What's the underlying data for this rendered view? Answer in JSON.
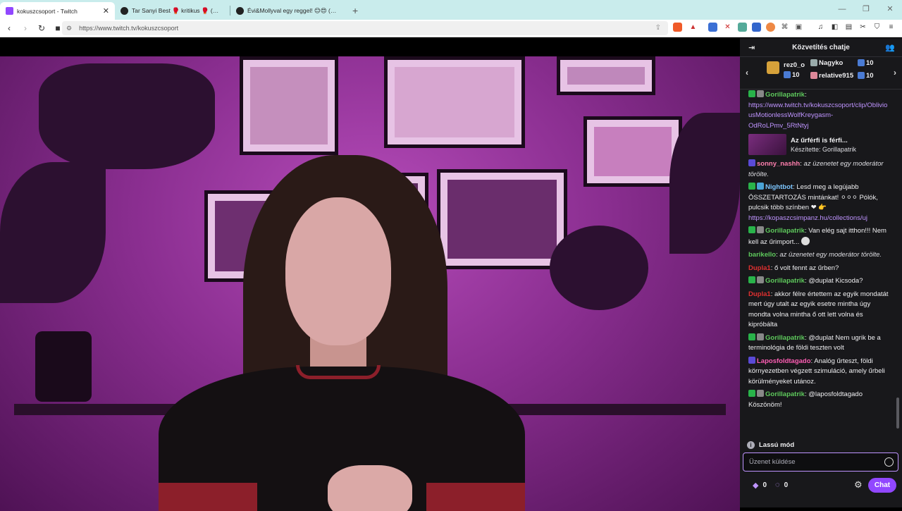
{
  "browser": {
    "tabs": [
      {
        "title": "kokuszcsoport - Twitch",
        "favicon_color": "#9147ff"
      },
      {
        "title": "Tar Sanyi Best 🥊 kritikus 🥊 (@szop",
        "favicon_color": "#222"
      },
      {
        "title": "Évi&Mollyval egy reggel! 😊😍 (@m",
        "favicon_color": "#222"
      }
    ],
    "newtab_label": "+",
    "url": "https://www.twitch.tv/kokuszcsoport"
  },
  "chat": {
    "header_title": "Közvetítés chatje",
    "leaderboard": [
      {
        "name": "rez0_o",
        "count": "10"
      },
      {
        "name": "Nagyko",
        "count": "10"
      },
      {
        "name": "relative915",
        "count": "10"
      }
    ],
    "messages": [
      {
        "user": "Gorillapatrik",
        "color": "#5ec95c",
        "text": "https://www.twitch.tv/kokuszcsoport/clip/ObliviousMotionlessWolfKreygasm-OdRoLPmv_5RtNtyj",
        "type": "link",
        "badges": [
          "mod",
          "vip"
        ]
      },
      {
        "user": "sonny_nashh",
        "color": "#ff7fae",
        "text": "az üzenetet egy moderátor törölte.",
        "type": "deleted",
        "badges": [
          "sub"
        ]
      },
      {
        "user": "Nightbot",
        "color": "#7dc6ff",
        "text": "Lesd meg a legújabb ÖSSZETARTOZÁS mintánkat! ⚪⚪⚪ Pólók, pulcsik több színben ❤ 👉 ",
        "link": "https://kopaszcsimpanz.hu/collections/uj",
        "type": "bot",
        "badges": [
          "mod",
          "bot"
        ]
      },
      {
        "user": "Gorillapatrik",
        "color": "#5ec95c",
        "text": "Van elég sajt itthon!!! Nem kell az űrimport...",
        "type": "normal",
        "badges": [
          "mod",
          "vip"
        ]
      },
      {
        "user": "barikello",
        "color": "#5ec95c",
        "text": "az üzenetet egy moderátor törölte.",
        "type": "deleted",
        "badges": []
      },
      {
        "user": "Dupla1",
        "color": "#e03030",
        "text": "ő volt fennt az űrben?",
        "type": "normal",
        "badges": []
      },
      {
        "user": "Gorillapatrik",
        "color": "#5ec95c",
        "text": "@duplat Kicsoda?",
        "type": "normal",
        "badges": [
          "mod",
          "vip"
        ]
      },
      {
        "user": "Dupla1",
        "color": "#e03030",
        "text": "akkor félre értettem az egyik mondatát mert úgy utalt az egyik esetre mintha úgy mondta volna mintha ő ott lett volna és kipróbálta",
        "type": "normal",
        "badges": []
      },
      {
        "user": "Gorillapatrik",
        "color": "#5ec95c",
        "text": "@duplat Nem ugrik be a terminológia de földi teszten volt",
        "type": "normal",
        "badges": [
          "mod",
          "vip"
        ]
      },
      {
        "user": "Laposfoldtagado",
        "color": "#ff5db4",
        "text": "Analóg űrteszt, földi környezetben végzett szimuláció, amely űrbeli körülményeket utánoz.",
        "type": "normal",
        "badges": [
          "sub"
        ]
      },
      {
        "user": "Gorillapatrik",
        "color": "#5ec95c",
        "text": "@laposfoldtagado Köszönöm!",
        "type": "normal",
        "badges": [
          "mod",
          "vip"
        ]
      }
    ],
    "clip_card": {
      "title": "Az űrférfi is férfi...",
      "creator": "Készítette: Gorillapatrik"
    },
    "slow_mode": "Lassú mód",
    "input_placeholder": "Üzenet küldése",
    "points_a": "0",
    "points_b": "0",
    "send_label": "Chat"
  }
}
